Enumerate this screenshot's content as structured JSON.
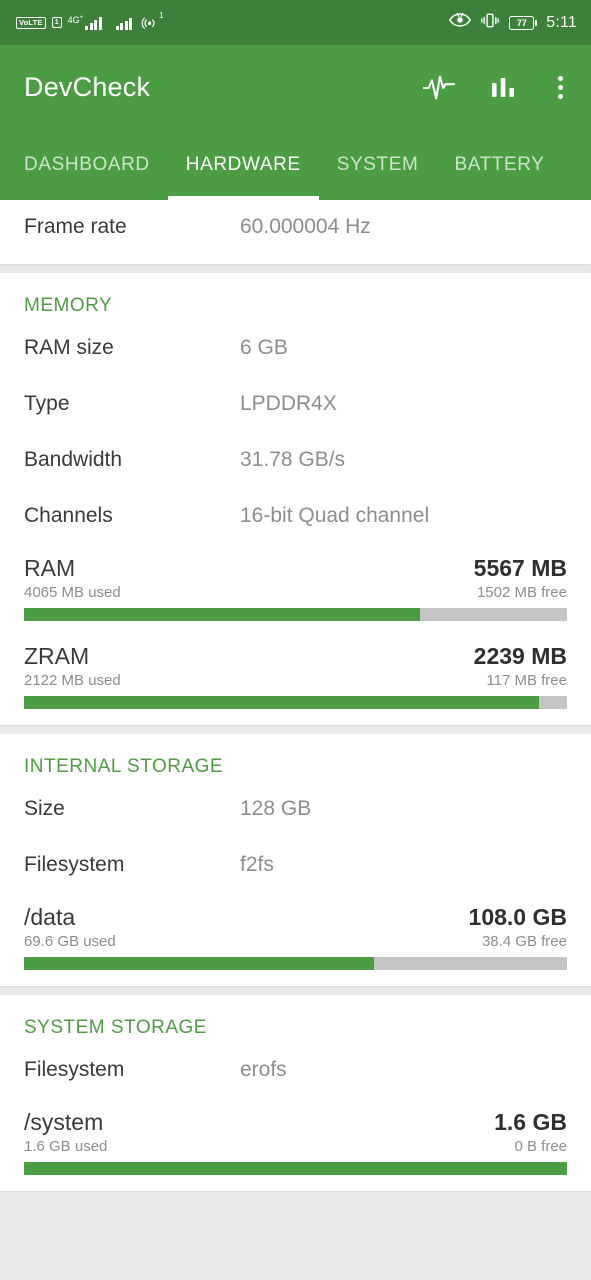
{
  "statusbar": {
    "volte_label": "VoLTE",
    "sim_label": "1",
    "network_gen": "4G",
    "network_gen_sup": "+",
    "hotspot_sup": "1",
    "battery_percent": "77",
    "time": "5:11",
    "icons": [
      "volte-icon",
      "sim-icon",
      "signal-bars-icon",
      "signal-bars-secondary-icon",
      "hotspot-icon",
      "eye-icon",
      "vibrate-icon",
      "battery-icon"
    ]
  },
  "toolbar": {
    "title": "DevCheck",
    "monitor_icon": "pulse-monitor-icon",
    "stats_icon": "bar-chart-icon",
    "overflow_icon": "overflow-menu-icon"
  },
  "tabs": [
    {
      "label": "DASHBOARD",
      "active": false
    },
    {
      "label": "HARDWARE",
      "active": true
    },
    {
      "label": "SYSTEM",
      "active": false
    },
    {
      "label": "BATTERY",
      "active": false
    }
  ],
  "display_card": {
    "rows": [
      {
        "key": "Frame rate",
        "value": "60.000004 Hz"
      }
    ]
  },
  "memory": {
    "section_title": "MEMORY",
    "rows": [
      {
        "key": "RAM size",
        "value": "6 GB"
      },
      {
        "key": "Type",
        "value": "LPDDR4X"
      },
      {
        "key": "Bandwidth",
        "value": "31.78 GB/s"
      },
      {
        "key": "Channels",
        "value": "16-bit Quad channel"
      }
    ],
    "meters": [
      {
        "name": "RAM",
        "total": "5567 MB",
        "used": "4065 MB used",
        "free": "1502 MB free",
        "percent": 73
      },
      {
        "name": "ZRAM",
        "total": "2239 MB",
        "used": "2122 MB used",
        "free": "117 MB free",
        "percent": 94.8
      }
    ]
  },
  "internal_storage": {
    "section_title": "INTERNAL STORAGE",
    "rows": [
      {
        "key": "Size",
        "value": "128 GB"
      },
      {
        "key": "Filesystem",
        "value": "f2fs"
      }
    ],
    "meters": [
      {
        "name": "/data",
        "total": "108.0 GB",
        "used": "69.6 GB used",
        "free": "38.4 GB free",
        "percent": 64.5
      }
    ]
  },
  "system_storage": {
    "section_title": "SYSTEM STORAGE",
    "rows": [
      {
        "key": "Filesystem",
        "value": "erofs"
      }
    ],
    "meters": [
      {
        "name": "/system",
        "total": "1.6 GB",
        "used": "1.6 GB used",
        "free": "0 B free",
        "percent": 100
      }
    ]
  },
  "colors": {
    "status_bar_green": "#3d803a",
    "toolbar_green": "#4c9c44",
    "section_header_green": "#519a44",
    "bar_fill_green": "#4c9c44",
    "bar_track_gray": "#c4c4c4"
  }
}
